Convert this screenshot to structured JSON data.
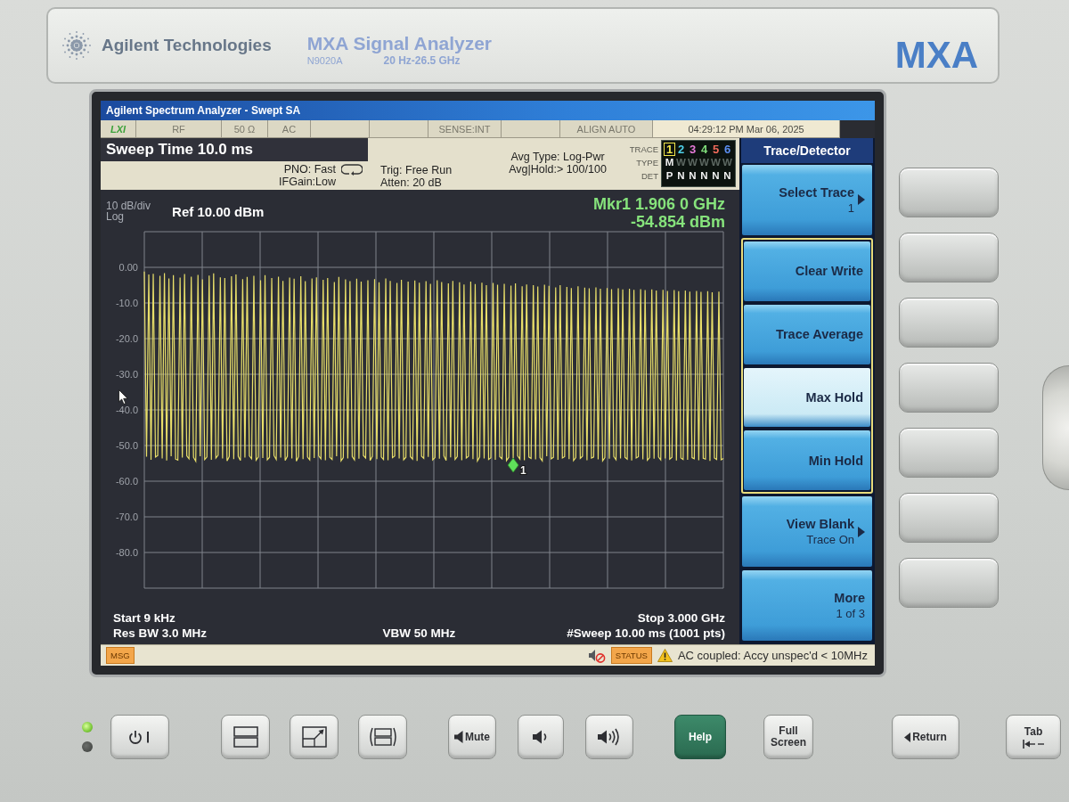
{
  "bezel": {
    "brand": "Agilent Technologies",
    "product": "MXA Signal Analyzer",
    "model": "N9020A",
    "range": "20 Hz-26.5 GHz",
    "badge": "MXA"
  },
  "screen": {
    "title": "Agilent Spectrum Analyzer - Swept SA",
    "status_cells": [
      {
        "kind": "logo",
        "text": "LXI"
      },
      {
        "kind": "text",
        "text": "RF"
      },
      {
        "kind": "text",
        "text": "50 Ω"
      },
      {
        "kind": "text",
        "text": "AC"
      },
      {
        "kind": "blank"
      },
      {
        "kind": "blank"
      },
      {
        "kind": "text",
        "text": "SENSE:INT"
      },
      {
        "kind": "blank"
      },
      {
        "kind": "text",
        "text": "ALIGN AUTO"
      },
      {
        "kind": "time",
        "text": "04:29:12 PM Mar 06, 2025"
      }
    ],
    "active_function": "Sweep Time 10.0 ms",
    "settings": {
      "pno": "PNO: Fast",
      "if_gain": "IFGain:Low",
      "trigger": "Trig: Free Run",
      "attenuation": "Atten: 20 dB",
      "avg_type": "Avg Type: Log-Pwr",
      "avg_hold": "Avg|Hold:> 100/100"
    },
    "trace_row_labels": [
      "TRACE",
      "TYPE",
      "DET"
    ],
    "traces": [
      {
        "number": "1",
        "color": "#f2e64a",
        "selected": true,
        "displayed": true,
        "type": "M",
        "detector": "P"
      },
      {
        "number": "2",
        "color": "#4fd0e8",
        "selected": false,
        "displayed": false,
        "type": "W",
        "detector": "N"
      },
      {
        "number": "3",
        "color": "#e57ad8",
        "selected": false,
        "displayed": false,
        "type": "W",
        "detector": "N"
      },
      {
        "number": "4",
        "color": "#7fdc7a",
        "selected": false,
        "displayed": false,
        "type": "W",
        "detector": "N"
      },
      {
        "number": "5",
        "color": "#f06a5a",
        "selected": false,
        "displayed": false,
        "type": "W",
        "detector": "N"
      },
      {
        "number": "6",
        "color": "#5b8ef0",
        "selected": false,
        "displayed": false,
        "type": "W",
        "detector": "N"
      }
    ],
    "graph": {
      "scale": "10 dB/div",
      "scale_type": "Log",
      "reference": "Ref 10.00 dBm",
      "marker_frequency": "Mkr1 1.906 0 GHz",
      "marker_amplitude": "-54.854 dBm",
      "chart_data": {
        "type": "line",
        "grid": true,
        "ylim": [
          -90,
          10
        ],
        "yticks": [
          {
            "value": 0,
            "label": "0.00"
          },
          {
            "value": -10,
            "label": "-10.0"
          },
          {
            "value": -20,
            "label": "-20.0"
          },
          {
            "value": -30,
            "label": "-30.0"
          },
          {
            "value": -40,
            "label": "-40.0"
          },
          {
            "value": -50,
            "label": "-50.0"
          },
          {
            "value": -60,
            "label": "-60.0"
          },
          {
            "value": -70,
            "label": "-70.0"
          },
          {
            "value": -80,
            "label": "-80.0"
          }
        ],
        "series": [
          {
            "color": "#e9df6a",
            "values": [
              -1.2,
              -53.1,
              -2.0,
              -54.0,
              -1.8,
              -53.2,
              -52.8,
              -2.4,
              -53.6,
              -1.6,
              -54.2,
              -3.1,
              -53.0,
              -2.2,
              -53.8,
              -54.1,
              -2.9,
              -53.4,
              -1.9,
              -52.9,
              -53.7,
              -2.6,
              -53.3,
              -54.4,
              -2.1,
              -53.0,
              -3.4,
              -53.9,
              -53.2,
              -2.3,
              -54.0,
              -1.7,
              -53.5,
              -52.7,
              -2.8,
              -53.6,
              -3.0,
              -54.3,
              -53.1,
              -2.5,
              -53.8,
              -2.0,
              -53.0,
              -54.2,
              -3.3,
              -53.4,
              -2.7,
              -52.9,
              -53.7,
              -2.4,
              -54.1,
              -53.2,
              -3.6,
              -53.5,
              -2.2,
              -54.0,
              -53.3,
              -3.0,
              -52.8,
              -53.9,
              -2.6,
              -53.4,
              -3.8,
              -54.2,
              -53.0,
              -2.9,
              -53.6,
              -3.2,
              -54.4,
              -53.1,
              -2.5,
              -53.8,
              -3.9,
              -53.2,
              -54.0,
              -3.1,
              -53.5,
              -2.8,
              -52.9,
              -53.7,
              -3.5,
              -54.1,
              -3.0,
              -53.3,
              -53.9,
              -4.1,
              -53.0,
              -2.7,
              -54.3,
              -53.4,
              -3.4,
              -53.6,
              -3.9,
              -53.1,
              -54.0,
              -3.2,
              -53.7,
              -4.0,
              -52.8,
              -53.5,
              -3.6,
              -54.2,
              -53.0,
              -3.3,
              -53.8,
              -4.2,
              -53.2,
              -53.9,
              -3.1,
              -54.1,
              -3.8,
              -53.4,
              -52.9,
              -4.4,
              -53.6,
              -3.5,
              -54.0,
              -53.3,
              -4.0,
              -53.1,
              -53.8,
              -3.7,
              -54.3,
              -4.3,
              -53.0,
              -53.6,
              -3.9,
              -53.2,
              -4.6,
              -54.0,
              -53.4,
              -3.6,
              -53.7,
              -4.1,
              -52.9,
              -54.2,
              -4.5,
              -53.3,
              -3.8,
              -53.9,
              -53.1,
              -4.2,
              -54.1,
              -4.8,
              -53.5,
              -53.0,
              -4.0,
              -53.8,
              -4.7,
              -54.3,
              -53.2,
              -4.3,
              -53.6,
              -5.0,
              -53.9,
              -53.4,
              -4.4,
              -54.0,
              -4.9,
              -53.1,
              -53.7,
              -4.6,
              -54.2,
              -53.3,
              -5.1,
              -53.5,
              -4.5,
              -52.9,
              -53.8,
              -5.3,
              -54.1,
              -4.8,
              -53.2,
              -53.6,
              -5.0,
              -53.9,
              -5.4,
              -53.4,
              -54.3,
              -4.9,
              -53.0,
              -5.2,
              -53.7,
              -53.3,
              -5.6,
              -54.0,
              -5.0,
              -53.5,
              -53.1,
              -5.5,
              -53.8,
              -5.8,
              -54.2,
              -53.4,
              -5.3,
              -53.6,
              -53.0,
              -5.7,
              -54.1,
              -5.9,
              -53.5,
              -53.2,
              -5.6,
              -53.9,
              -6.0,
              -54.3,
              -53.4,
              -5.8,
              -53.7,
              -6.1,
              -53.1,
              -54.0,
              -5.9,
              -53.6,
              -6.2,
              -53.3,
              -53.8,
              -6.0,
              -54.2,
              -6.3,
              -53.5,
              -53.1,
              -6.1,
              -53.9,
              -6.4,
              -54.1,
              -53.4,
              -6.2,
              -53.7,
              -6.5,
              -53.2,
              -54.0,
              -6.3,
              -53.6,
              -6.6,
              -53.8,
              -53.3,
              -6.4,
              -54.2,
              -6.7,
              -53.5,
              -53.9,
              -6.5,
              -54.0,
              -6.8,
              -53.4,
              -53.7,
              -6.6,
              -54.1,
              -6.9,
              -53.6,
              -53.8,
              -6.7,
              -54.3,
              -7.0,
              -53.5,
              -53.9,
              -6.8,
              -54.0,
              -53.6
            ]
          }
        ],
        "annotations": [
          "1"
        ]
      }
    },
    "footer": {
      "start": "Start 9 kHz",
      "res_bw": "Res BW 3.0 MHz",
      "vbw": "VBW 50 MHz",
      "stop": "Stop 3.000 GHz",
      "sweep": "#Sweep 10.00 ms (1001 pts)"
    },
    "status_bar": {
      "msg": "MSG",
      "sound_muted": true,
      "status": "STATUS",
      "message": "AC coupled: Accy unspec'd < 10MHz"
    },
    "softkeys": {
      "title": "Trace/Detector",
      "keys": [
        {
          "kind": "submenu",
          "label": "Select Trace",
          "value": "1"
        },
        {
          "kind": "group",
          "options": [
            {
              "label": "Clear Write",
              "selected": false
            },
            {
              "label": "Trace Average",
              "selected": false
            },
            {
              "label": "Max Hold",
              "selected": true
            },
            {
              "label": "Min Hold",
              "selected": false
            }
          ]
        },
        {
          "kind": "submenu",
          "label": "View Blank",
          "value": "Trace On"
        },
        {
          "kind": "more",
          "label": "More",
          "value": "1 of 3"
        }
      ]
    }
  },
  "leds": [
    {
      "on": true
    },
    {
      "on": false
    }
  ],
  "front_keys": [
    {
      "kind": "power"
    },
    {
      "kind": "split_screen"
    },
    {
      "kind": "zoom_window"
    },
    {
      "kind": "next_window"
    },
    {
      "kind": "mute",
      "label": "Mute"
    },
    {
      "kind": "volume_down"
    },
    {
      "kind": "volume_up"
    },
    {
      "kind": "help",
      "label": "Help"
    },
    {
      "kind": "full_screen",
      "label": "Full Screen"
    },
    {
      "kind": "return",
      "label": "Return"
    },
    {
      "kind": "tab",
      "label": "Tab"
    }
  ]
}
